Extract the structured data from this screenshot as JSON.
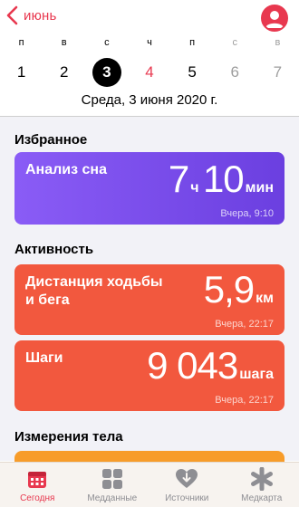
{
  "nav": {
    "back_label": "июнь"
  },
  "week": {
    "days": [
      {
        "wd": "п",
        "num": "1",
        "state": "normal"
      },
      {
        "wd": "в",
        "num": "2",
        "state": "normal"
      },
      {
        "wd": "с",
        "num": "3",
        "state": "selected"
      },
      {
        "wd": "ч",
        "num": "4",
        "state": "today"
      },
      {
        "wd": "п",
        "num": "5",
        "state": "normal"
      },
      {
        "wd": "с",
        "num": "6",
        "state": "muted"
      },
      {
        "wd": "в",
        "num": "7",
        "state": "muted"
      }
    ],
    "full_date": "Среда, 3 июня 2020 г."
  },
  "favorites": {
    "title": "Избранное",
    "sleep": {
      "label": "Анализ сна",
      "hours": "7",
      "hours_unit": "ч",
      "minutes": "10",
      "minutes_unit": "мин",
      "stamp": "Вчера, 9:10"
    }
  },
  "activity": {
    "title": "Активность",
    "distance": {
      "label_line1": "Дистанция ходьбы",
      "label_line2": "и бега",
      "value": "5,9",
      "unit": "км",
      "stamp": "Вчера, 22:17"
    },
    "steps": {
      "label": "Шаги",
      "value": "9 043",
      "unit": "шага",
      "stamp": "Вчера, 22:17"
    }
  },
  "body": {
    "title": "Измерения тела"
  },
  "tabs": [
    {
      "label": "Сегодня",
      "icon": "calendar-icon",
      "active": true
    },
    {
      "label": "Медданные",
      "icon": "grid-icon",
      "active": false
    },
    {
      "label": "Источники",
      "icon": "heart-download-icon",
      "active": false
    },
    {
      "label": "Медкарта",
      "icon": "asterisk-icon",
      "active": false
    }
  ],
  "colors": {
    "accent": "#e8384f",
    "sleep_card": "#7a4ee8",
    "activity_card": "#f2583e",
    "body_card": "#f79c2a"
  }
}
